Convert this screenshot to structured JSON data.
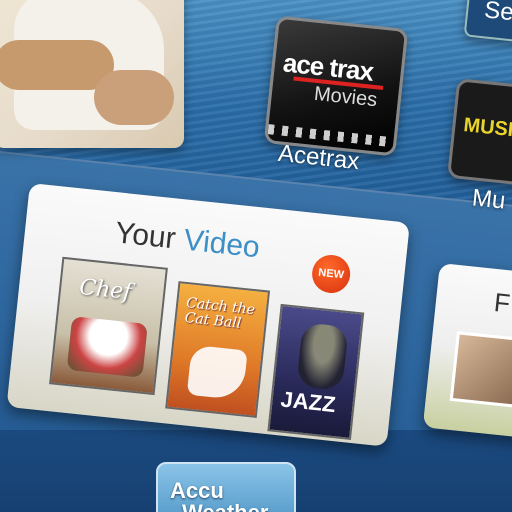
{
  "apps": {
    "acetrax": {
      "logo_line1": "ace trax",
      "logo_line2": "Movies",
      "label": "Acetrax"
    },
    "music": {
      "logo_text": "MUSI",
      "label": "Mu"
    },
    "search": {
      "label": "Se"
    }
  },
  "your_video": {
    "title_word1": "Your",
    "title_word2": "Video",
    "new_badge": "NEW",
    "posters": [
      {
        "title": "Chef"
      },
      {
        "title": "Catch the Cat Ball"
      },
      {
        "title": "JAZZ"
      }
    ]
  },
  "photos_panel": {
    "label": "F"
  },
  "accuweather": {
    "line1": "Accu",
    "line2": "Weather"
  },
  "colors": {
    "background_blue": "#2a6aa6",
    "title_blue": "#3d8fc7",
    "new_badge_red": "#e0401a"
  }
}
